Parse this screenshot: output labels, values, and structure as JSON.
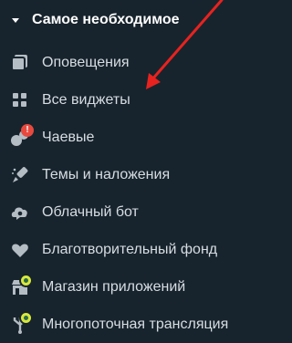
{
  "section": {
    "title": "Самое необходимое",
    "caret_icon": "caret-down-icon"
  },
  "items": [
    {
      "label": "Оповещения",
      "icon": "alerts-icon"
    },
    {
      "label": "Все виджеты",
      "icon": "widgets-grid-icon"
    },
    {
      "label": "Чаевые",
      "icon": "tips-icon",
      "badge": "!"
    },
    {
      "label": "Темы и наложения",
      "icon": "themes-brush-icon"
    },
    {
      "label": "Облачный бот",
      "icon": "cloudbot-icon"
    },
    {
      "label": "Благотворительный фонд",
      "icon": "heart-icon"
    },
    {
      "label": "Магазин приложений",
      "icon": "app-store-icon"
    },
    {
      "label": "Многопоточная трансляция",
      "icon": "multistream-icon"
    }
  ],
  "colors": {
    "background": "#17242d",
    "text": "#d7dde2",
    "icon": "#b5bdc4",
    "alert_badge": "#e8493f",
    "new_badge": "#d8e83b",
    "annotation_arrow": "#e8221f"
  }
}
